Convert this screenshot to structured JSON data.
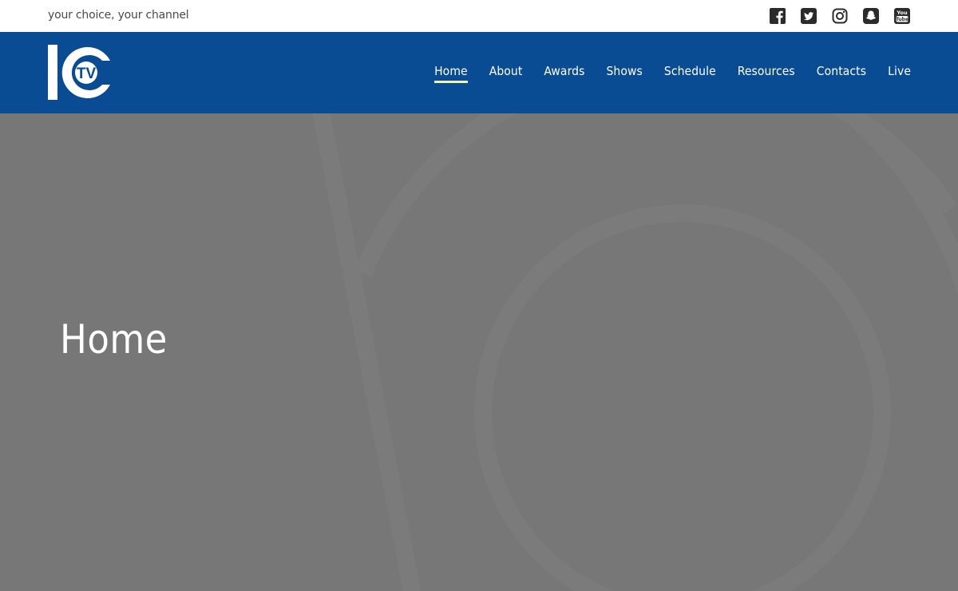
{
  "site": {
    "tagline": "your choice, your channel",
    "logo_alt": "ICTV",
    "logo_text": {
      "main": "IC",
      "badge": "TV"
    }
  },
  "social": [
    {
      "name": "facebook",
      "icon": "facebook-icon"
    },
    {
      "name": "twitter",
      "icon": "twitter-icon"
    },
    {
      "name": "instagram",
      "icon": "instagram-icon"
    },
    {
      "name": "snapchat",
      "icon": "snapchat-icon"
    },
    {
      "name": "youtube",
      "icon": "youtube-icon"
    }
  ],
  "nav": {
    "items": [
      {
        "label": "Home",
        "active": true
      },
      {
        "label": "About",
        "active": false
      },
      {
        "label": "Awards",
        "active": false
      },
      {
        "label": "Shows",
        "active": false
      },
      {
        "label": "Schedule",
        "active": false
      },
      {
        "label": "Resources",
        "active": false
      },
      {
        "label": "Contacts",
        "active": false
      },
      {
        "label": "Live",
        "active": false
      }
    ]
  },
  "hero": {
    "title": "Home"
  },
  "colors": {
    "header_bg": "#094c93",
    "hero_bg": "#777777",
    "active_underline": "#f5f3a8",
    "icon_color": "#2b2b2b"
  }
}
